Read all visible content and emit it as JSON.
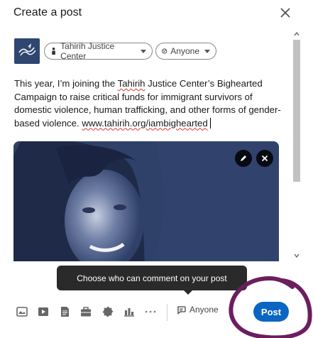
{
  "dialog": {
    "title": "Create a post",
    "close_icon": "close-icon"
  },
  "author": {
    "logo_icon": "organization-logo",
    "org_selector_label": "Tahirih Justice Center",
    "visibility_label": "Anyone"
  },
  "post": {
    "text_1": "This year, I’m joining the ",
    "text_tahirih": "Tahirih",
    "text_2": " Justice Center’s Bighearted Campaign to raise critical funds for immigrant survivors of domestic violence, human trafficking, and other forms of gender-based violence. ",
    "link": "www.tahirih.org/iambighearted"
  },
  "photo": {
    "edit_icon": "pencil-icon",
    "remove_icon": "close-icon"
  },
  "tooltip": {
    "text": "Choose who can comment on your post"
  },
  "toolbar": {
    "tools": [
      "photo-icon",
      "video-icon",
      "document-icon",
      "briefcase-icon",
      "badge-icon",
      "poll-icon",
      "more-icon"
    ],
    "comment_setting_label": "Anyone",
    "post_label": "Post"
  },
  "colors": {
    "accent": "#0a66c2",
    "photo_tint": "#2f4069",
    "annotation": "#6b1f5e"
  }
}
